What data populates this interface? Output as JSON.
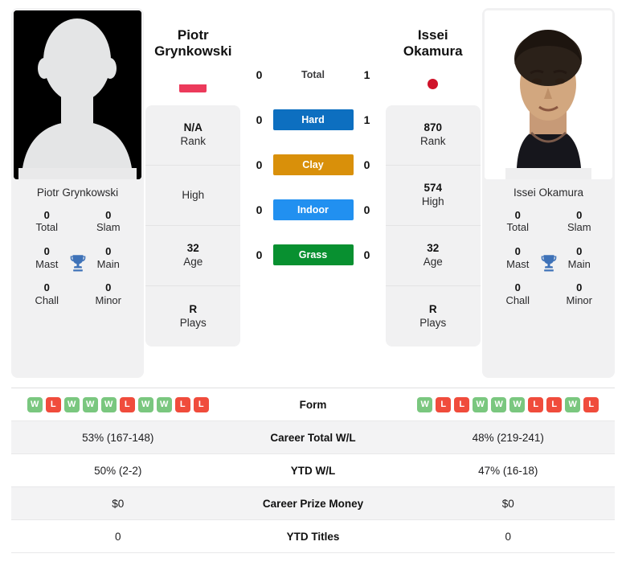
{
  "players": {
    "left": {
      "first_name": "Piotr",
      "last_name": "Grynkowski",
      "full_name": "Piotr Grynkowski",
      "country_flag": "poland-flag",
      "photo": "placeholder-silhouette",
      "titles": [
        {
          "value": "0",
          "label": "Total"
        },
        {
          "value": "0",
          "label": "Slam"
        },
        {
          "value": "0",
          "label": "Mast"
        },
        {
          "value": "0",
          "label": "Main"
        },
        {
          "value": "0",
          "label": "Chall"
        },
        {
          "value": "0",
          "label": "Minor"
        }
      ],
      "card": [
        {
          "value": "N/A",
          "label": "Rank"
        },
        {
          "value": "",
          "label": "High"
        },
        {
          "value": "32",
          "label": "Age"
        },
        {
          "value": "R",
          "label": "Plays"
        }
      ],
      "form": [
        "W",
        "L",
        "W",
        "W",
        "W",
        "L",
        "W",
        "W",
        "L",
        "L"
      ],
      "career_total_wl": "53% (167-148)",
      "ytd_wl": "50% (2-2)",
      "career_prize_money": "$0",
      "ytd_titles": "0"
    },
    "right": {
      "first_name": "Issei",
      "last_name": "Okamura",
      "full_name": "Issei Okamura",
      "country_flag": "japan-flag",
      "photo": "player-headshot",
      "titles": [
        {
          "value": "0",
          "label": "Total"
        },
        {
          "value": "0",
          "label": "Slam"
        },
        {
          "value": "0",
          "label": "Mast"
        },
        {
          "value": "0",
          "label": "Main"
        },
        {
          "value": "0",
          "label": "Chall"
        },
        {
          "value": "0",
          "label": "Minor"
        }
      ],
      "card": [
        {
          "value": "870",
          "label": "Rank"
        },
        {
          "value": "574",
          "label": "High"
        },
        {
          "value": "32",
          "label": "Age"
        },
        {
          "value": "R",
          "label": "Plays"
        }
      ],
      "form": [
        "W",
        "L",
        "L",
        "W",
        "W",
        "W",
        "L",
        "L",
        "W",
        "L"
      ],
      "career_total_wl": "48% (219-241)",
      "ytd_wl": "47% (16-18)",
      "career_prize_money": "$0",
      "ytd_titles": "0"
    }
  },
  "head_to_head": [
    {
      "label": "Total",
      "left": "0",
      "right": "1",
      "color": ""
    },
    {
      "label": "Hard",
      "left": "0",
      "right": "1",
      "color": "#0d6fc0"
    },
    {
      "label": "Clay",
      "left": "0",
      "right": "0",
      "color": "#d9900a"
    },
    {
      "label": "Indoor",
      "left": "0",
      "right": "0",
      "color": "#2190f0"
    },
    {
      "label": "Grass",
      "left": "0",
      "right": "0",
      "color": "#089030"
    }
  ],
  "stats_rows": [
    {
      "label": "Form",
      "left": "",
      "right": ""
    },
    {
      "label": "Career Total W/L",
      "left": "53% (167-148)",
      "right": "48% (219-241)"
    },
    {
      "label": "YTD W/L",
      "left": "50% (2-2)",
      "right": "47% (16-18)"
    },
    {
      "label": "Career Prize Money",
      "left": "$0",
      "right": "$0"
    },
    {
      "label": "YTD Titles",
      "left": "0",
      "right": "0"
    }
  ],
  "colors": {
    "win_badge": "#7ac77f",
    "loss_badge": "#f04c3c",
    "trophy": "#3e72b8",
    "card_background": "#f1f1f2"
  }
}
